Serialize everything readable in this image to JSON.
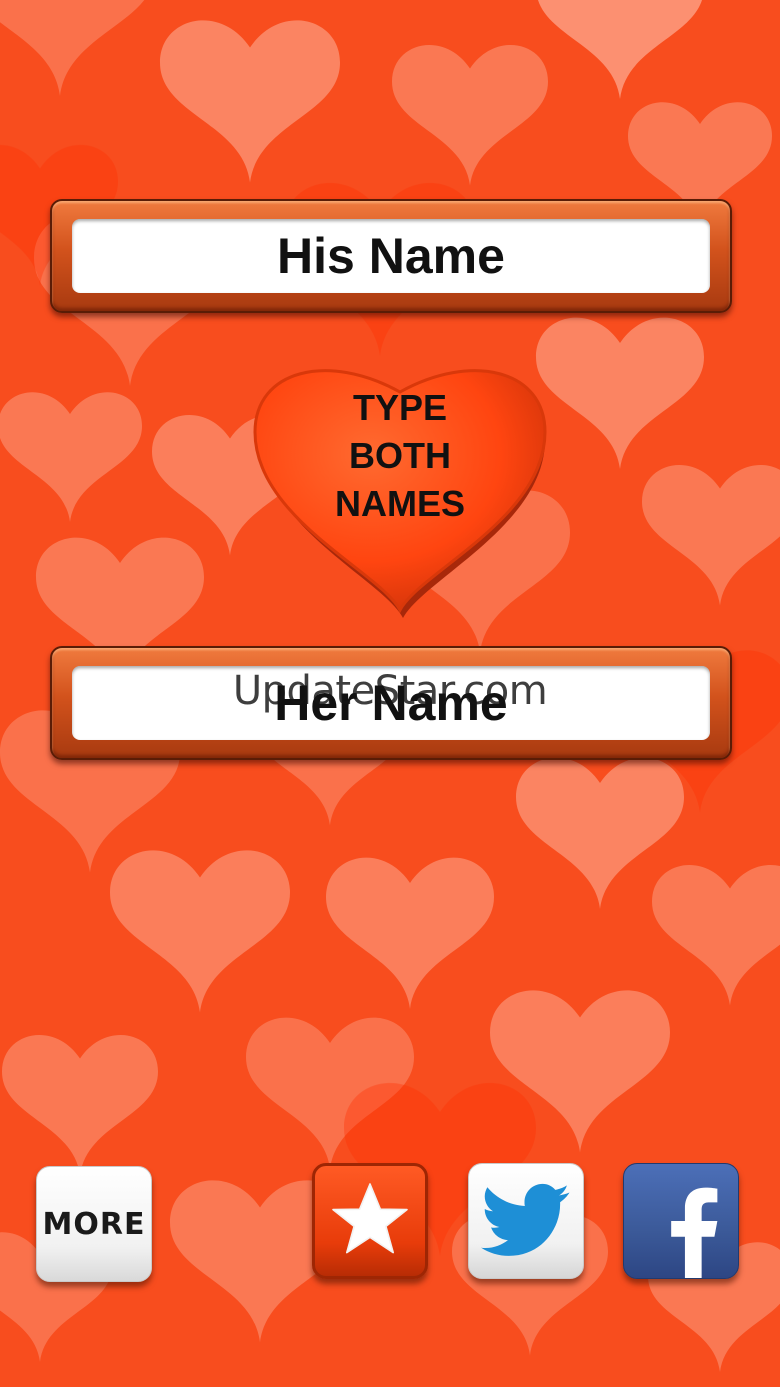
{
  "his_name": {
    "placeholder": "His Name",
    "value": ""
  },
  "center_heart": {
    "lines": [
      "TYPE",
      "BOTH",
      "NAMES"
    ]
  },
  "her_name": {
    "placeholder": "Her Name",
    "value": ""
  },
  "watermark": "UpdateStar.com",
  "bottom_bar": {
    "more_label": "MORE",
    "rate_icon": "star-icon",
    "twitter_icon": "twitter-bird-icon",
    "facebook_icon": "facebook-f-icon"
  },
  "colors": {
    "background": "#f4572a",
    "heart": "#ff4a14",
    "frame": "#d2521c",
    "twitter_blue": "#1e8fd6",
    "facebook_blue": "#3b5998"
  }
}
